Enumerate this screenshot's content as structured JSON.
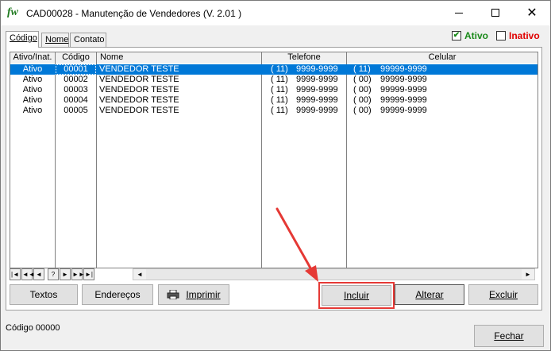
{
  "window": {
    "logo": "fw",
    "title": "CAD00028 - Manutenção de Vendedores  (V.  2.01 )"
  },
  "tabs": [
    {
      "label": "Código",
      "active": true
    },
    {
      "label": "Nome",
      "active": false
    },
    {
      "label": "Contato",
      "active": false
    }
  ],
  "filters": {
    "ativo_label": "Ativo",
    "ativo_checked": true,
    "ativo_color": "#1a8a1a",
    "inativo_label": "Inativo",
    "inativo_checked": false,
    "inativo_color": "#e00000"
  },
  "grid": {
    "columns": [
      "Ativo/Inat.",
      "Código",
      "Nome",
      "Telefone",
      "Celular"
    ],
    "rows": [
      {
        "status": "Ativo",
        "codigo": "00001",
        "nome": "VENDEDOR TESTE",
        "tel_ddd": "( 11)",
        "tel": "9999-9999",
        "cel_ddd": "( 11)",
        "cel": "99999-9999",
        "selected": true
      },
      {
        "status": "Ativo",
        "codigo": "00002",
        "nome": "VENDEDOR TESTE",
        "tel_ddd": "( 11)",
        "tel": "9999-9999",
        "cel_ddd": "( 00)",
        "cel": "99999-9999",
        "selected": false
      },
      {
        "status": "Ativo",
        "codigo": "00003",
        "nome": "VENDEDOR TESTE",
        "tel_ddd": "( 11)",
        "tel": "9999-9999",
        "cel_ddd": "( 00)",
        "cel": "99999-9999",
        "selected": false
      },
      {
        "status": "Ativo",
        "codigo": "00004",
        "nome": "VENDEDOR TESTE",
        "tel_ddd": "( 11)",
        "tel": "9999-9999",
        "cel_ddd": "( 00)",
        "cel": "99999-9999",
        "selected": false
      },
      {
        "status": "Ativo",
        "codigo": "00005",
        "nome": "VENDEDOR TESTE",
        "tel_ddd": "( 11)",
        "tel": "9999-9999",
        "cel_ddd": "( 00)",
        "cel": "99999-9999",
        "selected": false
      }
    ],
    "selection_color": "#0078d7"
  },
  "navigator": {
    "buttons": [
      "first-icon",
      "prev-page-icon",
      "prev-icon",
      "help-icon",
      "next-icon",
      "next-page-icon",
      "last-icon"
    ],
    "glyphs": [
      "|◄",
      "◄◄",
      "◄",
      "?",
      "►",
      "►►",
      "►|"
    ]
  },
  "actions": {
    "textos": "Textos",
    "enderecos": "Endereços",
    "imprimir": "Imprimir",
    "incluir": "Incluir",
    "alterar": "Alterar",
    "excluir": "Excluir",
    "fechar": "Fechar"
  },
  "status": {
    "text": "Código  00000"
  },
  "annotation": {
    "highlight_color": "#e53935"
  }
}
